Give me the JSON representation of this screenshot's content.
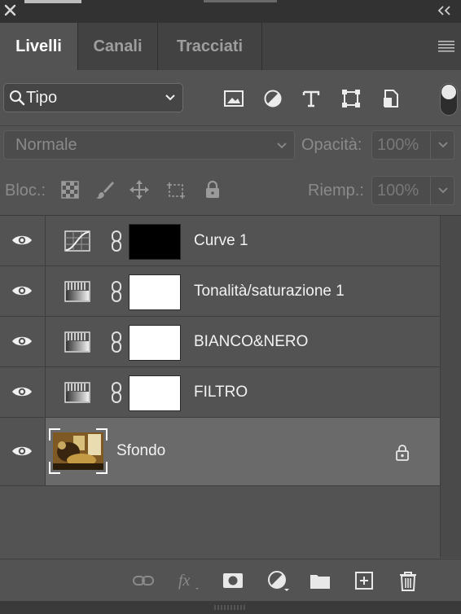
{
  "window": {
    "close_icon": "close-icon",
    "collapse_icon": "double-chevron-left-icon"
  },
  "tabs": [
    {
      "label": "Livelli",
      "active": true
    },
    {
      "label": "Canali",
      "active": false
    },
    {
      "label": "Tracciati",
      "active": false
    }
  ],
  "filter": {
    "kind_label": "Tipo",
    "icons": [
      "image-filter-icon",
      "adjustment-filter-icon",
      "type-filter-icon",
      "shape-filter-icon",
      "smart-object-filter-icon"
    ]
  },
  "blend": {
    "mode": "Normale",
    "opacity_label": "Opacità:",
    "opacity_value": "100%"
  },
  "lock": {
    "label": "Bloc.:",
    "fill_label": "Riemp.:",
    "fill_value": "100%"
  },
  "layers": [
    {
      "name": "Curve 1",
      "type": "curves",
      "mask": "black"
    },
    {
      "name": "Tonalità/saturazione 1",
      "type": "gradient-map",
      "mask": "white"
    },
    {
      "name": "BIANCO&NERO",
      "type": "gradient-map",
      "mask": "white"
    },
    {
      "name": "FILTRO",
      "type": "gradient-map",
      "mask": "white"
    },
    {
      "name": "Sfondo",
      "type": "background",
      "locked": true
    }
  ],
  "colors": {
    "panel": "#535353",
    "selected_layer": "#6a6a6a",
    "tab_bar": "#424242",
    "title_bar": "#323232"
  }
}
